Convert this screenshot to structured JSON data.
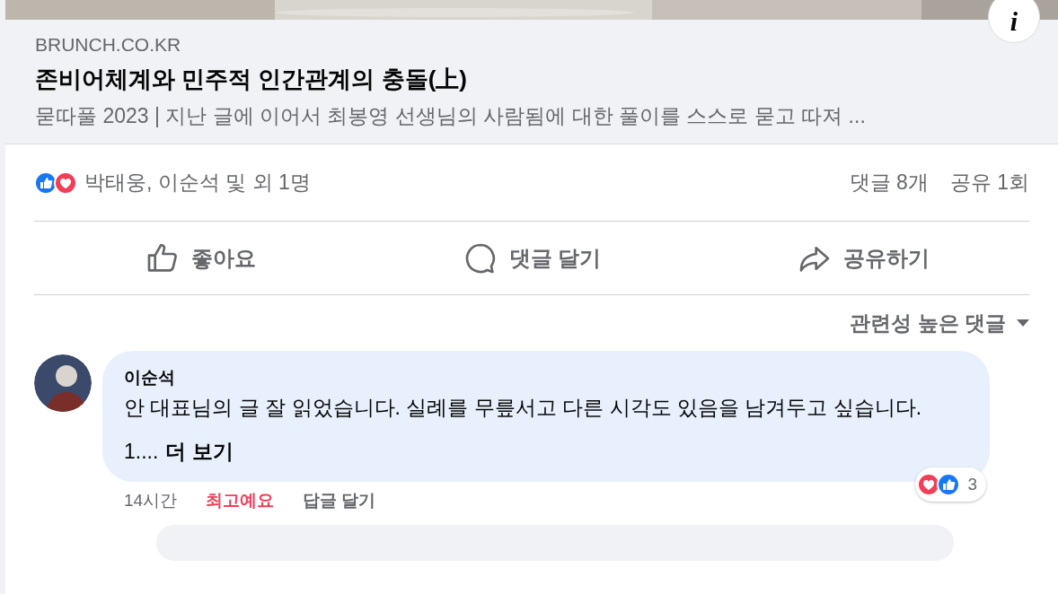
{
  "link_preview": {
    "kind": "picture",
    "info_button": "i",
    "domain": "BRUNCH.CO.KR",
    "title": "존비어체계와 민주적 인간관계의 충돌(上)",
    "description": "묻따풀 2023 | 지난 글에 이어서 최봉영 선생님의 사람됨에 대한 풀이를 스스로 묻고 따져 ..."
  },
  "reactions": {
    "names": "박태웅, 이순석 및 외 1명",
    "comments": "댓글 8개",
    "shares": "공유 1회"
  },
  "actions": [
    {
      "kind": "like",
      "label": "좋아요"
    },
    {
      "kind": "comment",
      "label": "댓글 달기"
    },
    {
      "kind": "share",
      "label": "공유하기"
    }
  ],
  "sort": {
    "label": "관련성 높은 댓글"
  },
  "comments": [
    {
      "author": "이순석",
      "text": "안 대표님의 글 잘 읽었습니다. 실례를 무릎서고 다른 시각도 있음을 남겨두고 싶습니다.",
      "truncated": "1....",
      "see_more": "더 보기",
      "reaction_count": "3",
      "time": "14시간",
      "actions": [
        {
          "label": "최고예요",
          "selected": true
        },
        {
          "label": "답글 달기",
          "selected": false
        }
      ]
    }
  ]
}
